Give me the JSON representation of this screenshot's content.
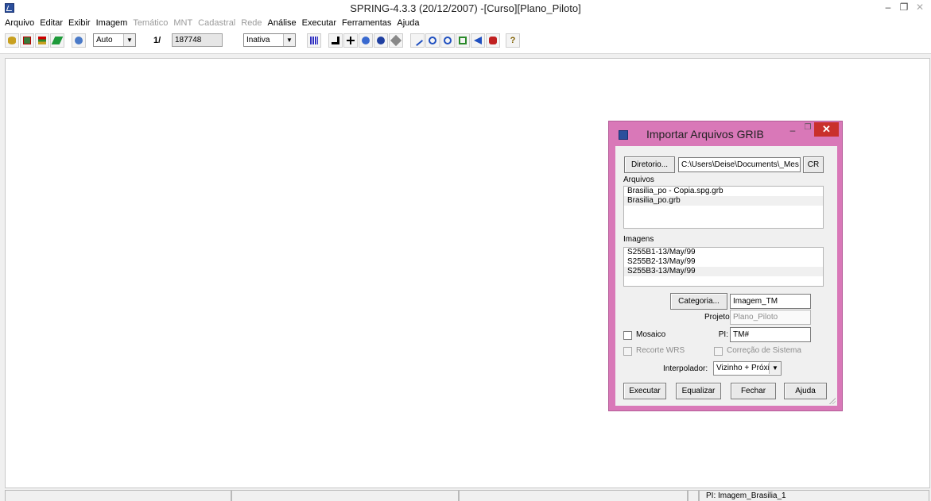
{
  "window": {
    "title": "SPRING-4.3.3 (20/12/2007) -[Curso][Plano_Piloto]",
    "controls": {
      "minimize": "–",
      "restore": "❐",
      "close": "✕"
    }
  },
  "menu": [
    {
      "label": "Arquivo",
      "enabled": true
    },
    {
      "label": "Editar",
      "enabled": true
    },
    {
      "label": "Exibir",
      "enabled": true
    },
    {
      "label": "Imagem",
      "enabled": true
    },
    {
      "label": "Temático",
      "enabled": false
    },
    {
      "label": "MNT",
      "enabled": false
    },
    {
      "label": "Cadastral",
      "enabled": false
    },
    {
      "label": "Rede",
      "enabled": false
    },
    {
      "label": "Análise",
      "enabled": true
    },
    {
      "label": "Executar",
      "enabled": true
    },
    {
      "label": "Ferramentas",
      "enabled": true
    },
    {
      "label": "Ajuda",
      "enabled": true
    }
  ],
  "toolbar": {
    "zoom_mode": "Auto",
    "scale_label": "1/",
    "scale_value": "187748",
    "state_select": "Inativa",
    "help_glyph": "?"
  },
  "dialog": {
    "title": "Importar Arquivos GRIB",
    "directory_button": "Diretorio...",
    "directory_path": "C:\\Users\\Deise\\Documents\\_Mes",
    "cr_button": "CR",
    "files_label": "Arquivos",
    "files": [
      "Brasilia_po - Copia.spg.grb",
      "Brasilia_po.grb"
    ],
    "images_label": "Imagens",
    "images": [
      "S255B1-13/May/99",
      "S255B2-13/May/99",
      "S255B3-13/May/99"
    ],
    "category_button": "Categoria...",
    "category_value": "Imagem_TM",
    "project_label": "Projeto:",
    "project_value": "Plano_Piloto",
    "mosaic_label": "Mosaico",
    "pi_label": "PI:",
    "pi_value": "TM#",
    "recorte_label": "Recorte WRS",
    "correcao_label": "Correção de Sistema",
    "interpolator_label": "Interpolador:",
    "interpolator_value": "Vizinho + Próximo",
    "buttons": {
      "execute": "Executar",
      "equalize": "Equalizar",
      "close": "Fechar",
      "help": "Ajuda"
    }
  },
  "status": {
    "pi": "PI: Imagem_Brasilia_1"
  },
  "colors": {
    "dialog_frame": "#d978b8",
    "close_button": "#c9302c",
    "toolbar_accent": "#2b4f9c"
  }
}
